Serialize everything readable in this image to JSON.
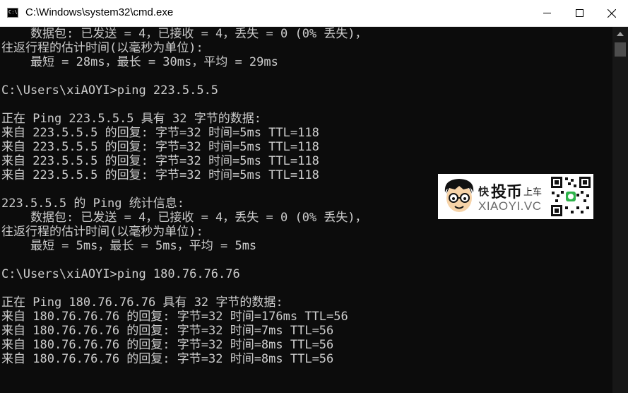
{
  "window": {
    "title": "C:\\Windows\\system32\\cmd.exe",
    "icon_text": "C:\\"
  },
  "console": {
    "lines": [
      "    数据包: 已发送 = 4，已接收 = 4，丢失 = 0 (0% 丢失)，",
      "往返行程的估计时间(以毫秒为单位):",
      "    最短 = 28ms，最长 = 30ms，平均 = 29ms",
      "",
      "C:\\Users\\xiAOYI>ping 223.5.5.5",
      "",
      "正在 Ping 223.5.5.5 具有 32 字节的数据:",
      "来自 223.5.5.5 的回复: 字节=32 时间=5ms TTL=118",
      "来自 223.5.5.5 的回复: 字节=32 时间=5ms TTL=118",
      "来自 223.5.5.5 的回复: 字节=32 时间=5ms TTL=118",
      "来自 223.5.5.5 的回复: 字节=32 时间=5ms TTL=118",
      "",
      "223.5.5.5 的 Ping 统计信息:",
      "    数据包: 已发送 = 4，已接收 = 4，丢失 = 0 (0% 丢失)，",
      "往返行程的估计时间(以毫秒为单位):",
      "    最短 = 5ms，最长 = 5ms，平均 = 5ms",
      "",
      "C:\\Users\\xiAOYI>ping 180.76.76.76",
      "",
      "正在 Ping 180.76.76.76 具有 32 字节的数据:",
      "来自 180.76.76.76 的回复: 字节=32 时间=176ms TTL=56",
      "来自 180.76.76.76 的回复: 字节=32 时间=7ms TTL=56",
      "来自 180.76.76.76 的回复: 字节=32 时间=8ms TTL=56",
      "来自 180.76.76.76 的回复: 字节=32 时间=8ms TTL=56"
    ]
  },
  "watermark": {
    "char": "快",
    "brand": "投币",
    "sub": "上车",
    "domain": "XIAOYI.VC"
  },
  "colors": {
    "console_bg": "#0c0c0c",
    "console_text": "#cccccc",
    "titlebar_bg": "#ffffff",
    "scrollbar_thumb": "#4d4d4d"
  },
  "icons": [
    "cmd-app-icon",
    "minimize-icon",
    "maximize-icon",
    "close-icon",
    "scroll-up-arrow-icon",
    "avatar-icon",
    "qr-code-icon"
  ]
}
